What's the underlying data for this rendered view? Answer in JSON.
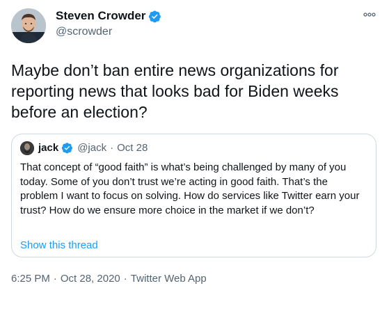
{
  "author": {
    "display_name": "Steven Crowder",
    "handle": "@scrowder",
    "verified": true
  },
  "tweet": {
    "text": "Maybe don’t ban entire news organizations for reporting news that looks bad for Biden weeks before an election?"
  },
  "quoted_tweet": {
    "display_name": "jack",
    "handle": "@jack",
    "separator": "·",
    "date": "Oct 28",
    "verified": true,
    "text": "That concept of “good faith” is what’s being challenged by many of you today. Some of you don’t trust we’re acting in good faith. That’s the problem I want to focus on solving. How do services like Twitter earn your trust? How do we ensure more choice in the market if we don’t?",
    "show_thread_label": "Show this thread"
  },
  "meta": {
    "time": "6:25 PM",
    "separator": "·",
    "date": "Oct 28, 2020",
    "source": "Twitter Web App"
  },
  "colors": {
    "accent": "#1d9bf0",
    "secondary_text": "#536471",
    "border": "#cfd9de"
  },
  "icons": {
    "verified": "verified-badge-icon",
    "more": "more-options-icon"
  }
}
